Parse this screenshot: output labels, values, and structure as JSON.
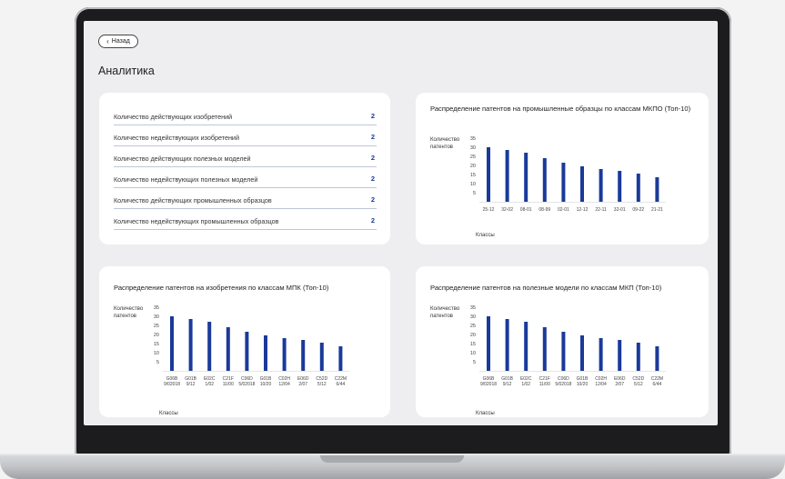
{
  "nav": {
    "back_label": "Назад"
  },
  "page": {
    "title": "Аналитика"
  },
  "stats": [
    {
      "label": "Количество действующих изобретений",
      "value": "2"
    },
    {
      "label": "Количество недействующих изобретений",
      "value": "2"
    },
    {
      "label": "Количество действующих полезных моделей",
      "value": "2"
    },
    {
      "label": "Количество недействующих полезных моделей",
      "value": "2"
    },
    {
      "label": "Количество действующих промышленных образцов",
      "value": "2"
    },
    {
      "label": "Количество недействующих промышленных образцов",
      "value": "2"
    }
  ],
  "colors": {
    "bar": "#1a3a9a",
    "accent": "#1a3a9a"
  },
  "chart_data": [
    {
      "type": "bar",
      "title": "Распределение патентов на промышленные образцы по классам МКПО (Топ-10)",
      "ylabel": "Количество патентов",
      "xlabel": "Классы",
      "ylim": [
        0,
        35
      ],
      "yticks": [
        "35",
        "30",
        "25",
        "20",
        "15",
        "10",
        "5"
      ],
      "categories": [
        "25-12",
        "32-02",
        "08-01",
        "08-99",
        "02-01",
        "12-12",
        "22-11",
        "32-01",
        "09-22",
        "21-21"
      ],
      "values": [
        30,
        28.5,
        27,
        24,
        21.5,
        19.5,
        18,
        17,
        15.5,
        13.5
      ]
    },
    {
      "type": "bar",
      "title": "Распределение патентов на изобретения по классам МПК (Топ-10)",
      "ylabel": "Количество патентов",
      "xlabel": "Классы",
      "ylim": [
        0,
        35
      ],
      "yticks": [
        "35",
        "30",
        "25",
        "20",
        "15",
        "10",
        "5"
      ],
      "categories": [
        "G06B 9/02018",
        "G01B 9/12",
        "E02C 1/02",
        "C21F 11/00",
        "C06D 5/02018",
        "G01B 10/20",
        "C02H 12/04",
        "E06D 2/07",
        "C52D 5/12",
        "C22M 6/44"
      ],
      "values": [
        30,
        28.5,
        27,
        24,
        21.5,
        19.5,
        18,
        17,
        15.5,
        13.5
      ]
    },
    {
      "type": "bar",
      "title": "Распределение патентов на полезные модели по классам МКП (Топ-10)",
      "ylabel": "Количество патентов",
      "xlabel": "Классы",
      "ylim": [
        0,
        35
      ],
      "yticks": [
        "35",
        "30",
        "25",
        "20",
        "15",
        "10",
        "5"
      ],
      "categories": [
        "G06B 9/02018",
        "G01B 9/12",
        "E02C 1/02",
        "C21F 11/00",
        "C06D 5/02018",
        "G01B 10/20",
        "C02H 12/04",
        "E06D 2/07",
        "C52D 5/12",
        "C22M 6/44"
      ],
      "values": [
        30,
        28.5,
        27,
        24,
        21.5,
        19.5,
        18,
        17,
        15.5,
        13.5
      ]
    }
  ]
}
